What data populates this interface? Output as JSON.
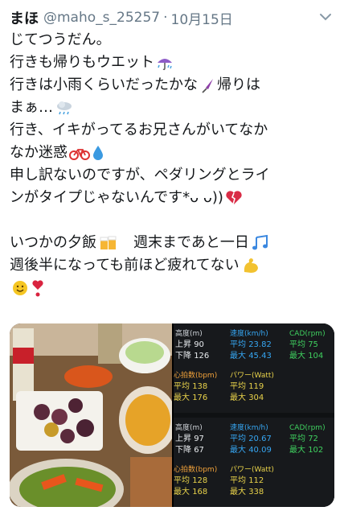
{
  "tweet": {
    "display_name": "まほ",
    "handle": "@maho_s_25257",
    "separator": "·",
    "date": "10月15日",
    "lines": [
      {
        "text": "じてつうだん。",
        "emoji": ""
      },
      {
        "text": "行きも帰りもウエット",
        "emoji": "umbrella-rain-icon"
      },
      {
        "text": "行きは小雨くらいだったかな",
        "emoji": "closed-umbrella-icon",
        "after": "帰りは"
      },
      {
        "text": "まぁ…",
        "emoji": "cloud-rain-icon"
      },
      {
        "text": "行き、イキがってるお兄さんがいてなか",
        "emoji": ""
      },
      {
        "text": "なか迷惑",
        "emoji": "bicycle-icon",
        "emoji2": "droplet-icon"
      },
      {
        "text": "申し訳ないのですが、ペダリングとライ",
        "emoji": ""
      },
      {
        "text": "ンがタイプじゃないんです*ᴗ ᴗ))",
        "emoji": "broken-heart-icon"
      },
      {
        "text": "",
        "emoji": ""
      },
      {
        "text": "いつかの夕飯",
        "emoji": "beer-mugs-icon",
        "after": "　週末まであと一日",
        "emoji2": "music-notes-icon"
      },
      {
        "text": "週後半になっても前ほど疲れてない",
        "emoji": "flexed-biceps-icon"
      },
      {
        "text": "",
        "emoji": "smiling-face-icon",
        "emoji2": "exclamation-heart-icon"
      }
    ]
  },
  "stats": [
    {
      "altitude_label": "高度(m)",
      "climb_label": "上昇",
      "climb": "90",
      "descent_label": "下降",
      "descent": "126",
      "speed_label": "速度(km/h)",
      "speed_avg_label": "平均",
      "speed_avg": "23.82",
      "speed_max_label": "最大",
      "speed_max": "45.43",
      "cad_label": "CAD(rpm)",
      "cad_avg_label": "平均",
      "cad_avg": "75",
      "cad_max_label": "最大",
      "cad_max": "104",
      "hr_label": "心拍数(bpm)",
      "hr_avg_label": "平均",
      "hr_avg": "138",
      "hr_max_label": "最大",
      "hr_max": "176",
      "power_label": "パワー(Watt)",
      "power_avg_label": "平均",
      "power_avg": "119",
      "power_max_label": "最大",
      "power_max": "304"
    },
    {
      "altitude_label": "高度(m)",
      "climb_label": "上昇",
      "climb": "97",
      "descent_label": "下降",
      "descent": "67",
      "speed_label": "速度(km/h)",
      "speed_avg_label": "平均",
      "speed_avg": "20.67",
      "speed_max_label": "最大",
      "speed_max": "40.09",
      "cad_label": "CAD(rpm)",
      "cad_avg_label": "平均",
      "cad_avg": "72",
      "cad_max_label": "最大",
      "cad_max": "102",
      "hr_label": "心拍数(bpm)",
      "hr_avg_label": "平均",
      "hr_avg": "128",
      "hr_max_label": "最大",
      "hr_max": "168",
      "power_label": "パワー(Watt)",
      "power_avg_label": "平均",
      "power_avg": "112",
      "power_max_label": "最大",
      "power_max": "338"
    }
  ]
}
